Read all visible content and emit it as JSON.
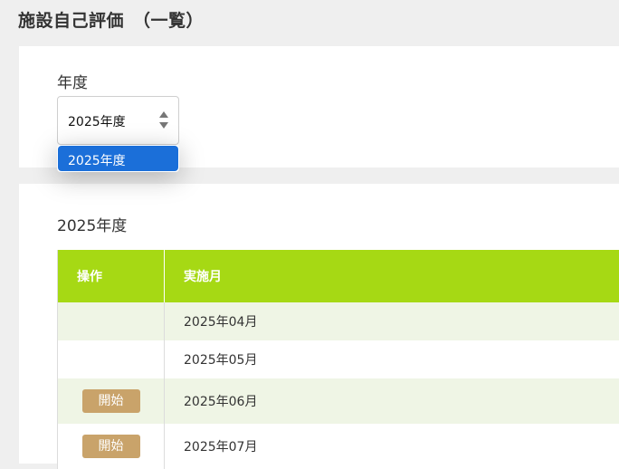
{
  "page": {
    "title": "施設自己評価　（一覧）"
  },
  "year_filter": {
    "label": "年度",
    "selected": "2025年度",
    "options": [
      "2025年度"
    ]
  },
  "section": {
    "heading": "2025年度",
    "table": {
      "columns": {
        "operation": "操作",
        "month": "実施月"
      },
      "rows": [
        {
          "month": "2025年04月",
          "action": ""
        },
        {
          "month": "2025年05月",
          "action": ""
        },
        {
          "month": "2025年06月",
          "action": "開始"
        },
        {
          "month": "2025年07月",
          "action": "開始"
        }
      ]
    }
  },
  "colors": {
    "header_green": "#a6d914",
    "row_tint": "#eff5e5",
    "button_tan": "#c9a36a",
    "dropdown_highlight": "#1b6fd9"
  },
  "icons": {
    "select": "up-down-arrows-icon"
  }
}
